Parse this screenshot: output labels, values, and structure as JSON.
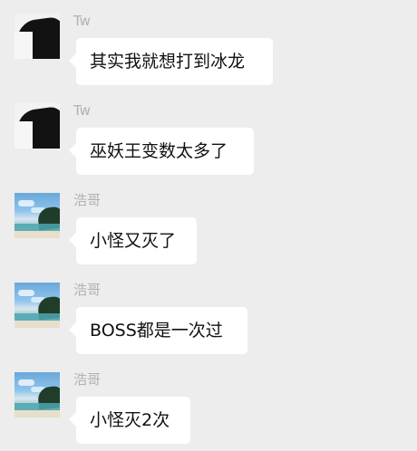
{
  "messages": [
    {
      "sender": "Tw",
      "text": "其实我就想打到冰龙",
      "avatar": "dark-avatar-icon"
    },
    {
      "sender": "Tw",
      "text": "巫妖王变数太多了",
      "avatar": "dark-avatar-icon"
    },
    {
      "sender": "浩哥",
      "text": "小怪又灭了",
      "avatar": "beach-avatar-icon"
    },
    {
      "sender": "浩哥",
      "text": "BOSS都是一次过",
      "avatar": "beach-avatar-icon"
    },
    {
      "sender": "浩哥",
      "text": "小怪灭2次",
      "avatar": "beach-avatar-icon"
    }
  ],
  "colors": {
    "background": "#ededed",
    "bubble": "#ffffff",
    "name": "#b2b2b2",
    "text": "#111111"
  }
}
